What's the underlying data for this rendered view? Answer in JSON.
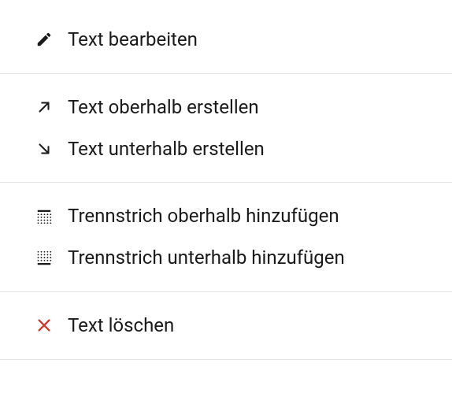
{
  "menu": {
    "edit_label": "Text bearbeiten",
    "create_above_label": "Text oberhalb erstellen",
    "create_below_label": "Text unterhalb erstellen",
    "separator_above_label": "Trennstrich oberhalb hinzufügen",
    "separator_below_label": "Trennstrich unterhalb hinzufügen",
    "delete_label": "Text löschen"
  },
  "colors": {
    "danger": "#d93025",
    "text": "#1a1a1a"
  }
}
